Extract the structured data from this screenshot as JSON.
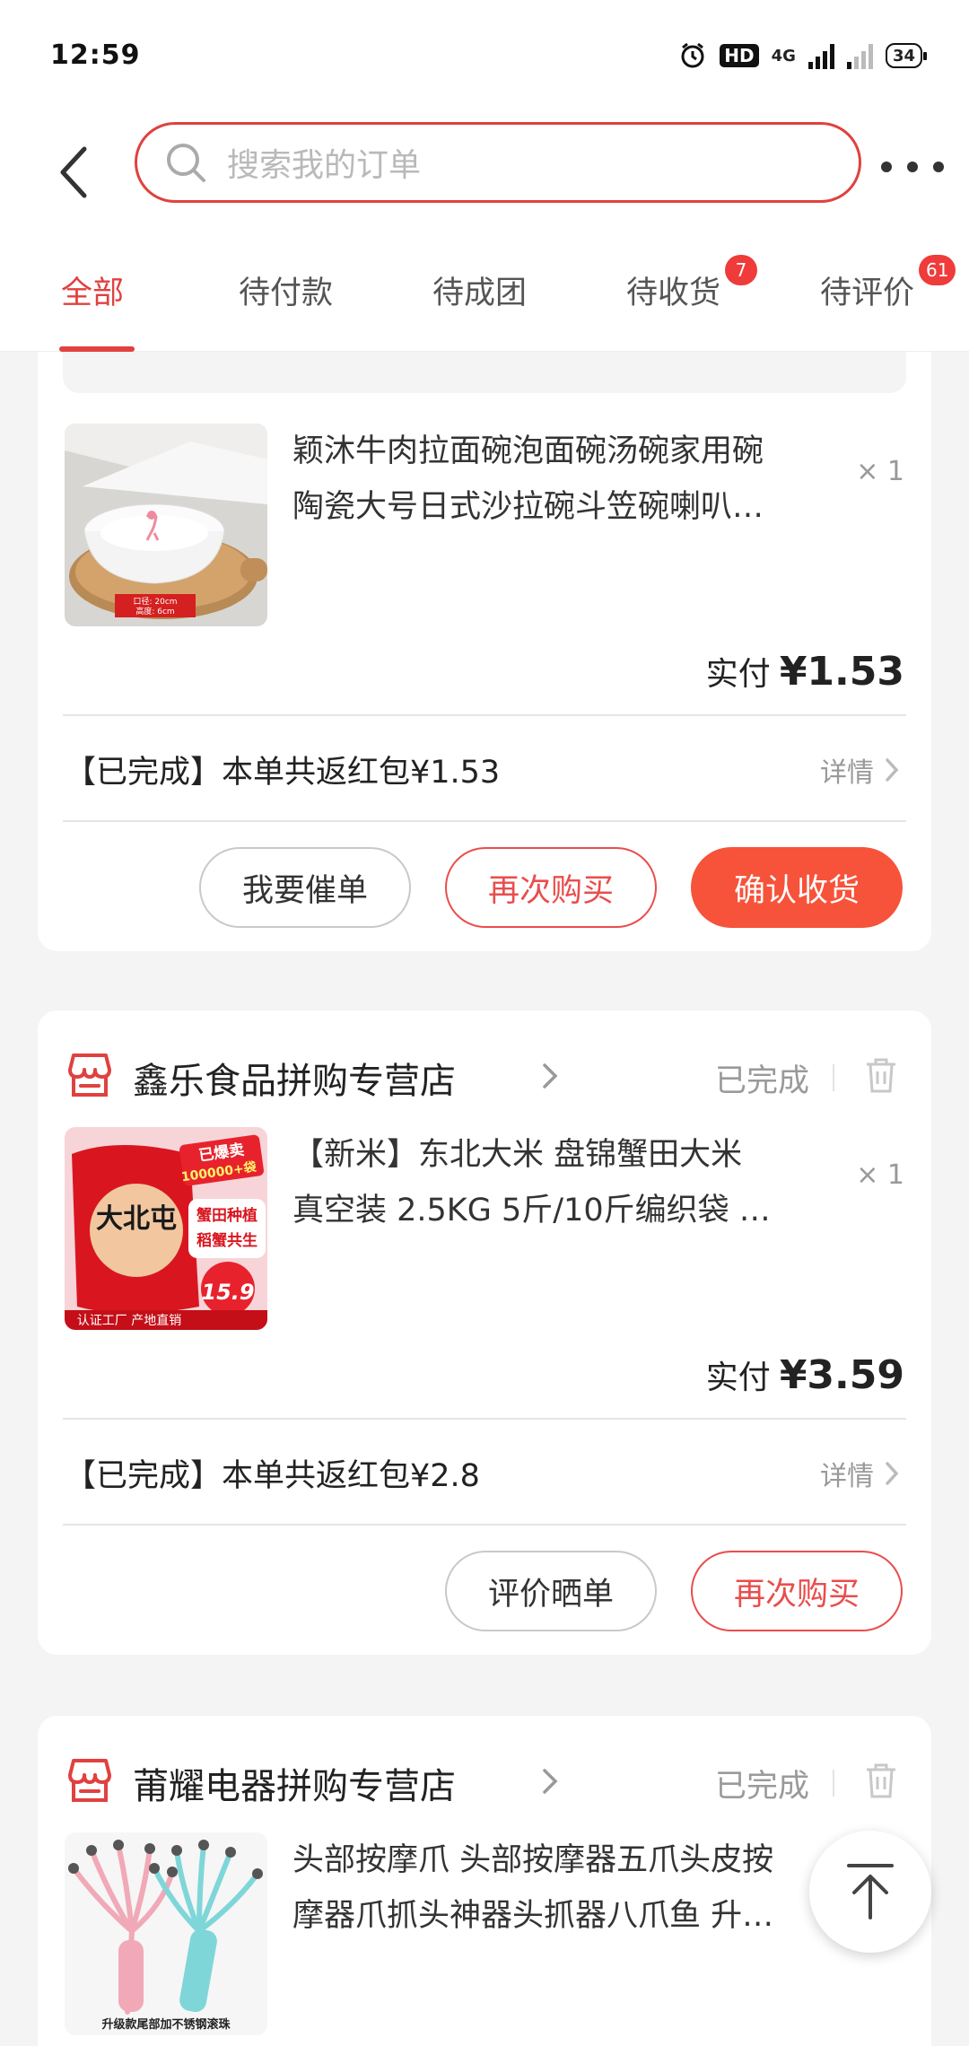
{
  "status_bar": {
    "time": "12:59",
    "hd_label": "HD",
    "net_label": "4G",
    "battery": "34"
  },
  "search": {
    "placeholder": "搜索我的订单"
  },
  "tabs": [
    {
      "label": "全部",
      "active": true
    },
    {
      "label": "待付款"
    },
    {
      "label": "待成团"
    },
    {
      "label": "待收货",
      "badge": "7"
    },
    {
      "label": "待评价",
      "badge": "61"
    }
  ],
  "orders": [
    {
      "product": {
        "title_line1": "颖沐牛肉拉面碗泡面碗汤碗家用碗",
        "title_line2": "陶瓷大号日式沙拉碗斗笠碗喇叭…",
        "qty": "× 1",
        "image_caption": "口径: 20cm 高度: 6cm"
      },
      "paid_label": "实付",
      "paid_amount": "¥1.53",
      "rebate": "【已完成】本单共返红包¥1.53",
      "detail_label": "详情",
      "buttons": [
        "我要催单",
        "再次购买",
        "确认收货"
      ]
    },
    {
      "store": "鑫乐食品拼购专营店",
      "status": "已完成",
      "product": {
        "title_line1": "【新米】东北大米 盘锦蟹田大米",
        "title_line2": "真空装 2.5KG 5斤/10斤编织袋 …",
        "qty": "× 1",
        "image_badge1": "已爆卖",
        "image_badge2": "100000+袋",
        "image_brand": "大北屯",
        "image_tag1": "蟹田种植",
        "image_tag2": "稻蟹共生",
        "image_price": "15.9",
        "image_footer": "认证工厂 产地直销"
      },
      "paid_label": "实付",
      "paid_amount": "¥3.59",
      "rebate": "【已完成】本单共返红包¥2.8",
      "detail_label": "详情",
      "buttons": [
        "评价晒单",
        "再次购买"
      ]
    },
    {
      "store": "莆耀电器拼购专营店",
      "status": "已完成",
      "product": {
        "title_line1": "头部按摩爪 头部按摩器五爪头皮按",
        "title_line2": "摩器爪抓头神器头抓器八爪鱼 升…",
        "image_caption": "升级款尾部加不锈钢滚珠"
      }
    }
  ],
  "colors": {
    "accent": "#e0413f",
    "confirm_button": "#f6533a",
    "background": "#f4f4f4"
  }
}
